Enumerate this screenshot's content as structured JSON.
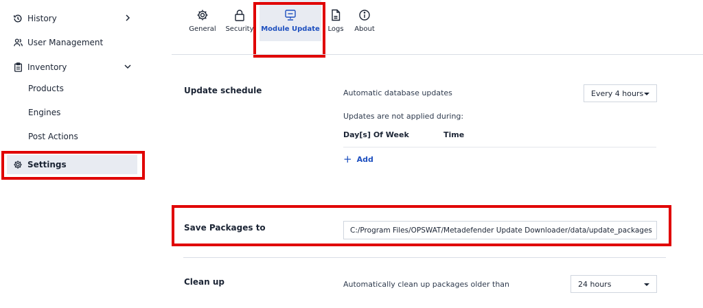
{
  "sidebar": {
    "items": [
      {
        "label": "History",
        "icon": "history-icon"
      },
      {
        "label": "User Management",
        "icon": "users-icon"
      },
      {
        "label": "Inventory",
        "icon": "clipboard-icon"
      },
      {
        "label": "Products"
      },
      {
        "label": "Engines"
      },
      {
        "label": "Post Actions"
      },
      {
        "label": "Settings",
        "icon": "gear-icon",
        "active": true
      }
    ]
  },
  "tabs": [
    {
      "label": "General",
      "icon": "gear-icon"
    },
    {
      "label": "Security",
      "icon": "lock-icon"
    },
    {
      "label": "Module Update",
      "icon": "monitor-icon",
      "active": true
    },
    {
      "label": "Logs",
      "icon": "document-icon"
    },
    {
      "label": "About",
      "icon": "info-icon"
    }
  ],
  "update_schedule": {
    "title": "Update schedule",
    "auto_label": "Automatic database updates",
    "auto_value": "Every 4 hours",
    "not_applied_label": "Updates are not applied during:",
    "col_days": "Day[s] Of Week",
    "col_time": "Time",
    "add_label": "Add"
  },
  "save_packages": {
    "title": "Save Packages to",
    "path": "C:/Program Files/OPSWAT/Metadefender Update Downloader/data/update_packages"
  },
  "clean_up": {
    "title": "Clean up",
    "label": "Automatically clean up packages older than",
    "value": "24 hours"
  },
  "colors": {
    "accent": "#1d4fbf",
    "highlight": "#e00000",
    "active_bg": "#e8ebf2"
  }
}
